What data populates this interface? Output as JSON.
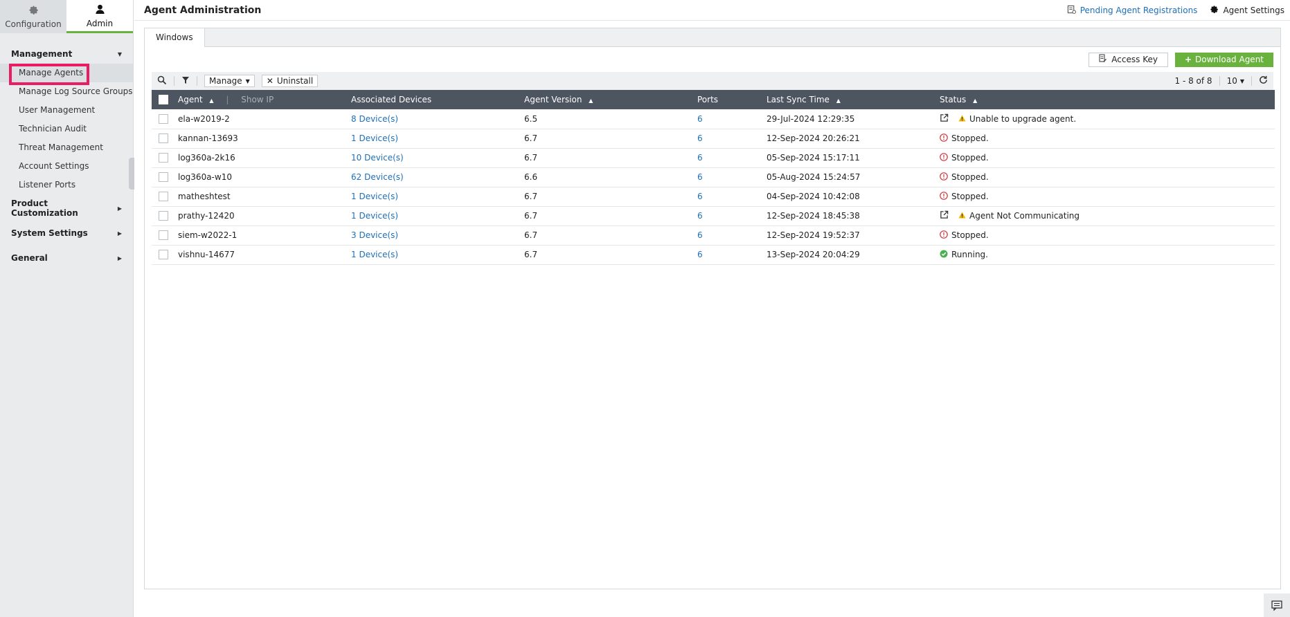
{
  "sidebar": {
    "tabs": [
      {
        "label": "Configuration",
        "icon": "gear-icon"
      },
      {
        "label": "Admin",
        "icon": "user-icon"
      }
    ],
    "groups": [
      {
        "label": "Management",
        "expanded": true,
        "items": [
          {
            "label": "Manage Agents",
            "active": true
          },
          {
            "label": "Manage Log Source Groups"
          },
          {
            "label": "User Management"
          },
          {
            "label": "Technician Audit"
          },
          {
            "label": "Threat Management"
          },
          {
            "label": "Account Settings"
          },
          {
            "label": "Listener Ports"
          }
        ]
      },
      {
        "label": "Product Customization",
        "expanded": false
      },
      {
        "label": "System Settings",
        "expanded": false
      },
      {
        "label": "General",
        "expanded": false
      }
    ]
  },
  "header": {
    "title": "Agent Administration",
    "pending_link": "Pending Agent Registrations",
    "settings_link": "Agent Settings"
  },
  "tabs": [
    "Windows"
  ],
  "actions": {
    "access_key": "Access Key",
    "download_agent": "Download Agent"
  },
  "toolbar": {
    "manage": "Manage",
    "uninstall": "Uninstall",
    "pagination": "1 - 8 of 8",
    "page_size": "10"
  },
  "table": {
    "columns": {
      "agent": "Agent",
      "show_ip": "Show IP",
      "devices": "Associated Devices",
      "version": "Agent Version",
      "ports": "Ports",
      "last_sync": "Last Sync Time",
      "status": "Status"
    },
    "rows": [
      {
        "agent": "ela-w2019-2",
        "devices": "8 Device(s)",
        "version": "6.5",
        "ports": "6",
        "last_sync": "29-Jul-2024 12:29:35",
        "status": "Unable to upgrade agent.",
        "status_type": "warning"
      },
      {
        "agent": "kannan-13693",
        "devices": "1 Device(s)",
        "version": "6.7",
        "ports": "6",
        "last_sync": "12-Sep-2024 20:26:21",
        "status": "Stopped.",
        "status_type": "stopped"
      },
      {
        "agent": "log360a-2k16",
        "devices": "10 Device(s)",
        "version": "6.7",
        "ports": "6",
        "last_sync": "05-Sep-2024 15:17:11",
        "status": "Stopped.",
        "status_type": "stopped"
      },
      {
        "agent": "log360a-w10",
        "devices": "62 Device(s)",
        "version": "6.6",
        "ports": "6",
        "last_sync": "05-Aug-2024 15:24:57",
        "status": "Stopped.",
        "status_type": "stopped"
      },
      {
        "agent": "matheshtest",
        "devices": "1 Device(s)",
        "version": "6.7",
        "ports": "6",
        "last_sync": "04-Sep-2024 10:42:08",
        "status": "Stopped.",
        "status_type": "stopped"
      },
      {
        "agent": "prathy-12420",
        "devices": "1 Device(s)",
        "version": "6.7",
        "ports": "6",
        "last_sync": "12-Sep-2024 18:45:38",
        "status": "Agent Not Communicating",
        "status_type": "warning"
      },
      {
        "agent": "siem-w2022-1",
        "devices": "3 Device(s)",
        "version": "6.7",
        "ports": "6",
        "last_sync": "12-Sep-2024 19:52:37",
        "status": "Stopped.",
        "status_type": "stopped"
      },
      {
        "agent": "vishnu-14677",
        "devices": "1 Device(s)",
        "version": "6.7",
        "ports": "6",
        "last_sync": "13-Sep-2024 20:04:29",
        "status": "Running.",
        "status_type": "running"
      }
    ]
  },
  "colors": {
    "accent_green": "#6ab23e",
    "header_dark": "#4c5560",
    "link_blue": "#1d6fb8",
    "highlight_pink": "#ea1d63"
  }
}
